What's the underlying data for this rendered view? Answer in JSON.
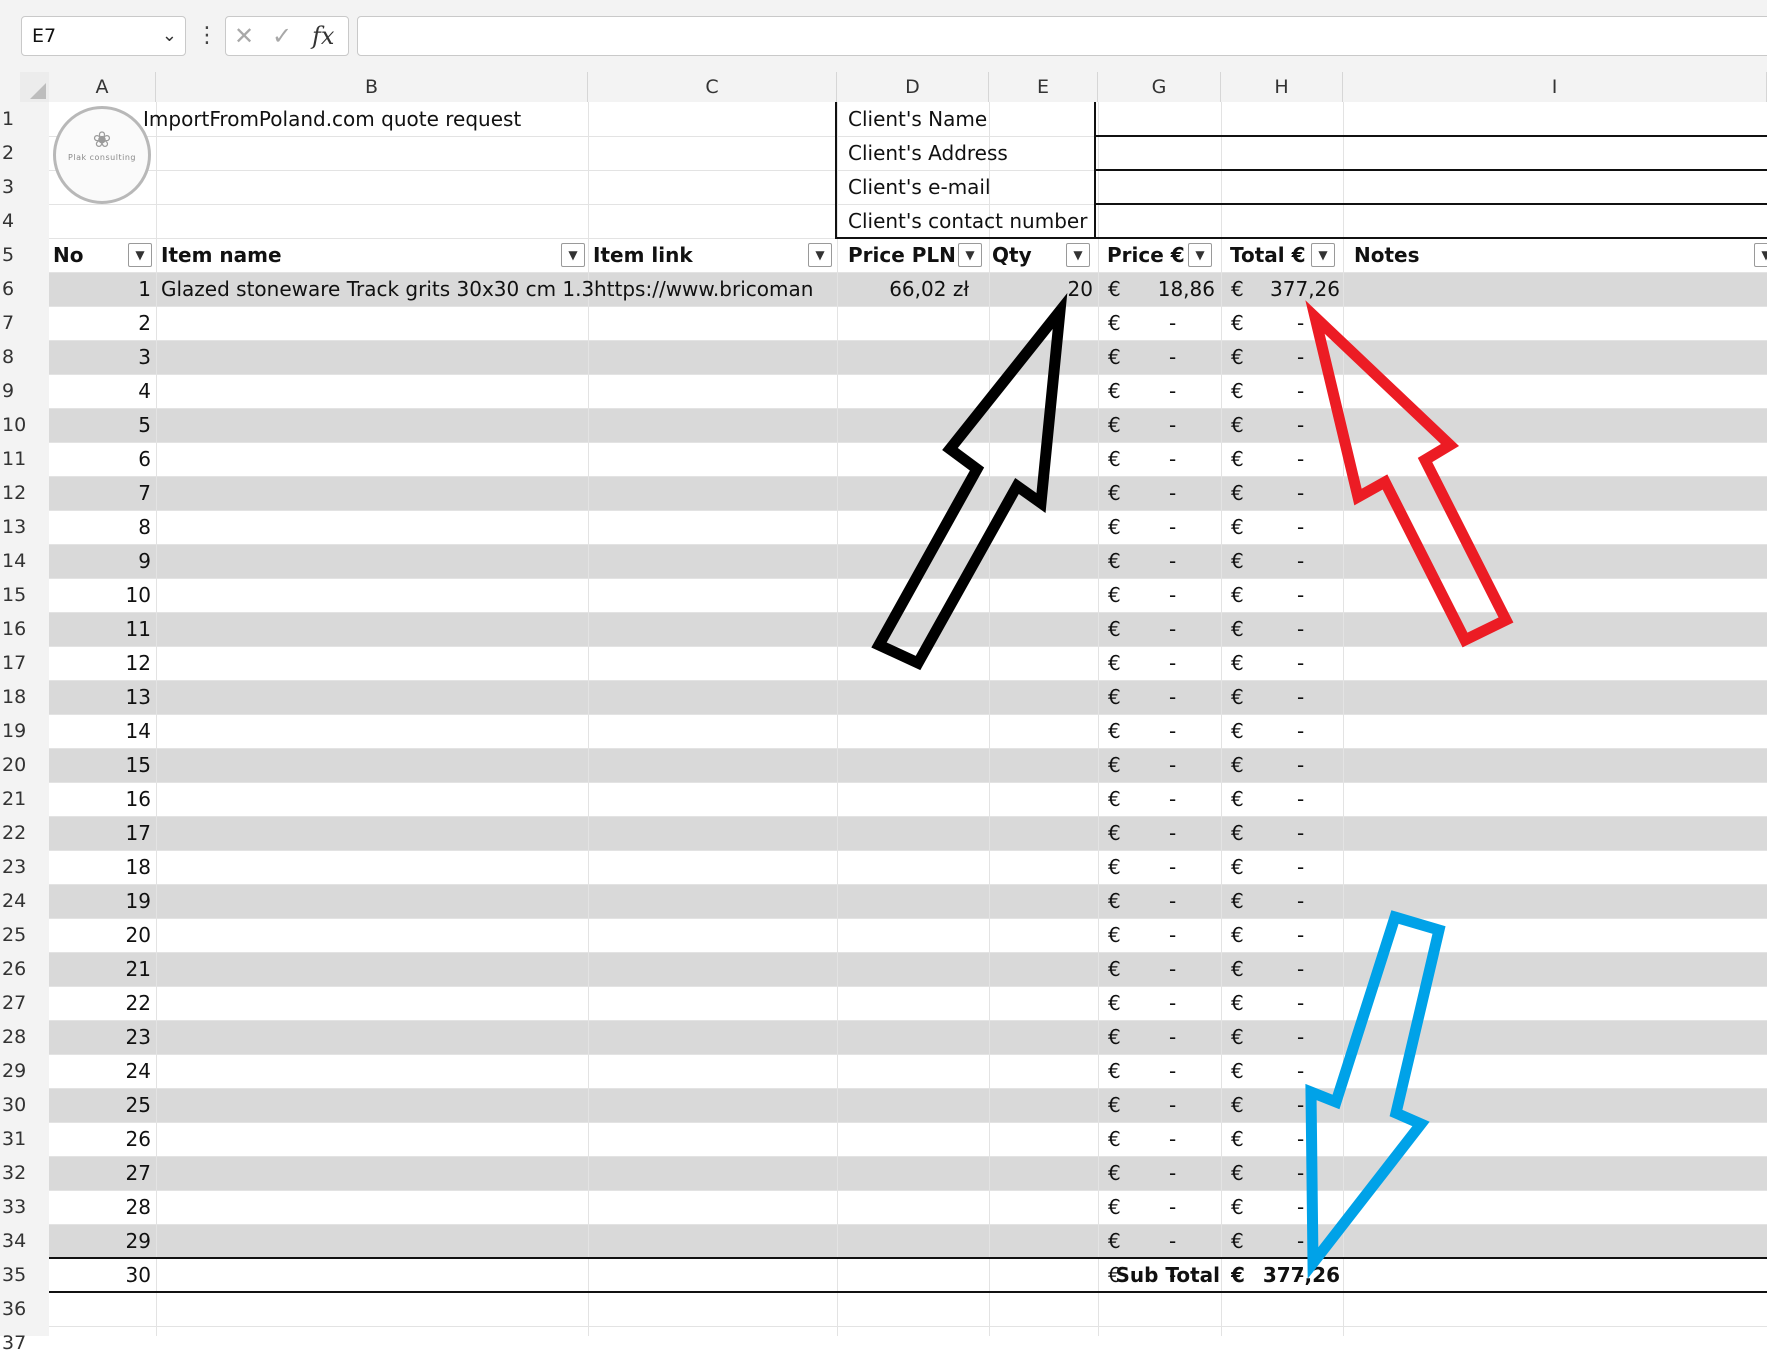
{
  "formula_bar": {
    "name_box": "E7",
    "formula": ""
  },
  "columns": [
    "A",
    "B",
    "C",
    "D",
    "E",
    "G",
    "H",
    "I"
  ],
  "rows": [
    "1",
    "2",
    "3",
    "4",
    "5",
    "6",
    "7",
    "8",
    "9",
    "10",
    "11",
    "12",
    "13",
    "14",
    "15",
    "16",
    "17",
    "18",
    "19",
    "20",
    "21",
    "22",
    "23",
    "24",
    "25",
    "26",
    "27",
    "28",
    "29",
    "30",
    "31",
    "32",
    "33",
    "34",
    "35",
    "36",
    "37"
  ],
  "sheet": {
    "title": "ImportFromPoland.com quote request",
    "logo_text": "Plak consulting",
    "client_labels": [
      "Client's Name",
      "Client's Address",
      "Client's e-mail",
      "Client's contact number"
    ],
    "headers": {
      "no": "No",
      "item_name": "Item name",
      "item_link": "Item link",
      "price_pln": "Price PLN",
      "qty": "Qty",
      "price_eur": "Price €",
      "total_eur": "Total €",
      "notes": "Notes"
    },
    "first_item": {
      "no": "1",
      "name": "Glazed stoneware Track grits 30x30 cm 1.3",
      "link": "https://www.bricoman",
      "price_pln": "66,02 zł",
      "qty": "20",
      "price_eur": "18,86",
      "total_eur": "377,26"
    },
    "currency": "€",
    "dash": "-",
    "subtotal_label": "Sub Total",
    "subtotal_value": "377,26"
  },
  "colors": {
    "band": "#d9d9d9",
    "arrow_black": "#000000",
    "arrow_red": "#ec1c24",
    "arrow_blue": "#00a2e8"
  },
  "icons": [
    "chevron-down-icon",
    "more-options-icon",
    "cancel-x-icon",
    "enter-check-icon",
    "function-fx-icon",
    "filter-dropdown-icon"
  ]
}
